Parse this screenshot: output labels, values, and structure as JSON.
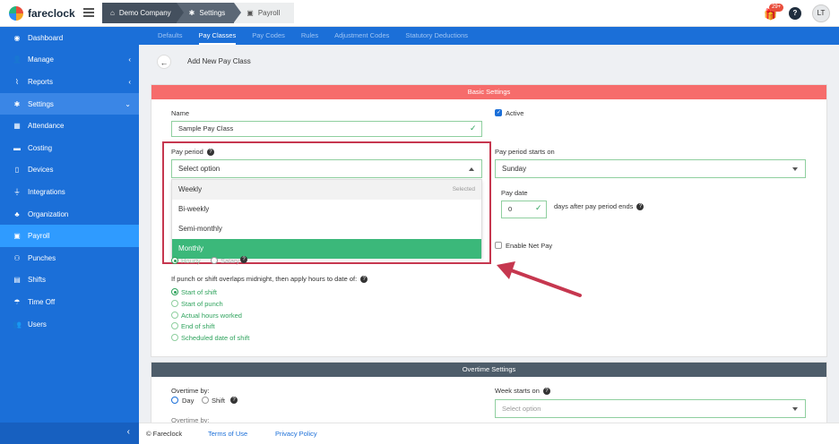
{
  "brand": {
    "name": "fareclock"
  },
  "breadcrumbs": [
    {
      "label": "Demo Company",
      "icon": "home-icon"
    },
    {
      "label": "Settings",
      "icon": "gear-icon"
    },
    {
      "label": "Payroll",
      "icon": "payroll-icon"
    }
  ],
  "header": {
    "notification_count": "29+",
    "help": "?",
    "avatar_initials": "LT"
  },
  "sidebar": {
    "items": [
      {
        "label": "Dashboard",
        "icon": "dashboard-icon"
      },
      {
        "label": "Manage",
        "icon": "user-icon",
        "arrow": "‹"
      },
      {
        "label": "Reports",
        "icon": "chart-icon",
        "arrow": "‹"
      },
      {
        "label": "Settings",
        "icon": "gear-icon",
        "arrow": "⌄"
      },
      {
        "label": "Attendance",
        "icon": "attendance-icon"
      },
      {
        "label": "Costing",
        "icon": "costing-icon"
      },
      {
        "label": "Devices",
        "icon": "device-icon"
      },
      {
        "label": "Integrations",
        "icon": "plug-icon"
      },
      {
        "label": "Organization",
        "icon": "org-icon"
      },
      {
        "label": "Payroll",
        "icon": "payroll-icon"
      },
      {
        "label": "Punches",
        "icon": "punch-icon"
      },
      {
        "label": "Shifts",
        "icon": "shift-icon"
      },
      {
        "label": "Time Off",
        "icon": "umbrella-icon"
      },
      {
        "label": "Users",
        "icon": "users-icon"
      }
    ],
    "collapse": "‹"
  },
  "tabs": [
    {
      "label": "Defaults"
    },
    {
      "label": "Pay Classes"
    },
    {
      "label": "Pay Codes"
    },
    {
      "label": "Rules"
    },
    {
      "label": "Adjustment Codes"
    },
    {
      "label": "Statutory Deductions"
    }
  ],
  "page": {
    "title": "Add New Pay Class",
    "back": "←"
  },
  "basic": {
    "section_title": "Basic Settings",
    "name_label": "Name",
    "name_value": "Sample Pay Class",
    "active_label": "Active",
    "pay_period_label": "Pay period",
    "pay_period_placeholder": "Select option",
    "pay_period_options": [
      {
        "label": "Weekly",
        "tag": "Selected"
      },
      {
        "label": "Bi-weekly"
      },
      {
        "label": "Semi-monthly"
      },
      {
        "label": "Monthly"
      }
    ],
    "starts_on_label": "Pay period starts on",
    "starts_on_value": "Sunday",
    "pay_date_label": "Pay date",
    "pay_date_value": "0",
    "pay_date_suffix": "days after pay period ends",
    "net_pay_label": "Enable Net Pay",
    "hourly_label": "Hourly",
    "salary_label": "Salary",
    "midnight_label": "If punch or shift overlaps midnight, then apply hours to date of:",
    "midnight_options": [
      "Start of shift",
      "Start of punch",
      "Actual hours worked",
      "End of shift",
      "Scheduled date of shift"
    ]
  },
  "overtime": {
    "section_title": "Overtime Settings",
    "by_label": "Overtime by:",
    "day_label": "Day",
    "shift_label": "Shift",
    "week_starts_label": "Week starts on",
    "week_starts_placeholder": "Select option",
    "overtime_by2": "Overtime by:"
  },
  "footer": {
    "copyright": "© Fareclock",
    "terms": "Terms of Use",
    "privacy": "Privacy Policy"
  },
  "colors": {
    "sidebar": "#1b6fd8",
    "basic_header": "#f66c6b",
    "overtime_header": "#4e5d6a",
    "highlight": "#c6374f",
    "accent_green": "#3bb87a"
  }
}
